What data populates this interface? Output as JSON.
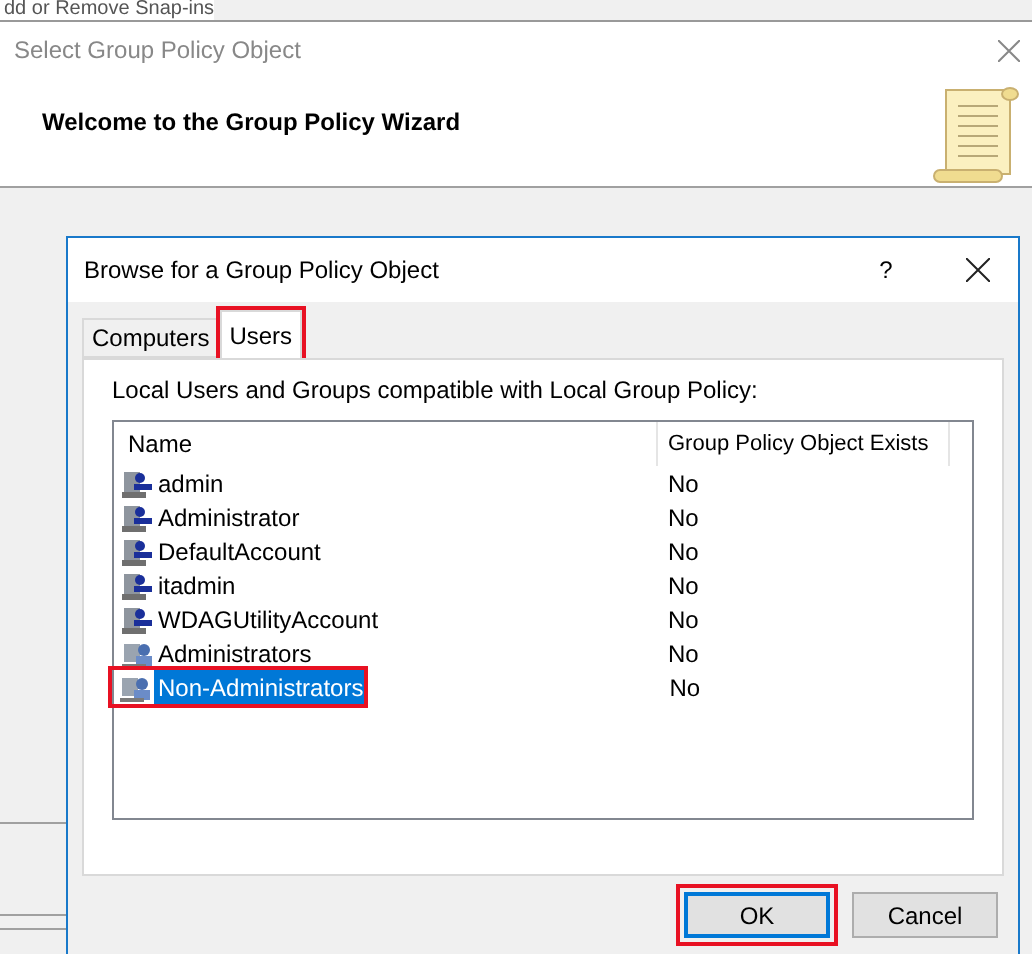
{
  "background_window": {
    "caption": "dd or Remove Snap-ins"
  },
  "wizard": {
    "title": "Select Group Policy Object",
    "heading": "Welcome to the Group Policy Wizard"
  },
  "dialog": {
    "title": "Browse for a Group Policy Object",
    "help": "?",
    "tabs": [
      {
        "label": "Computers",
        "selected": false,
        "highlighted": false
      },
      {
        "label": "Users",
        "selected": true,
        "highlighted": true
      }
    ],
    "list_label": "Local Users and Groups compatible with Local Group Policy:",
    "columns": [
      "Name",
      "Group Policy Object Exists"
    ],
    "rows": [
      {
        "kind": "user",
        "name": "admin",
        "exists": "No",
        "selected": false,
        "highlighted": false
      },
      {
        "kind": "user",
        "name": "Administrator",
        "exists": "No",
        "selected": false,
        "highlighted": false
      },
      {
        "kind": "user",
        "name": "DefaultAccount",
        "exists": "No",
        "selected": false,
        "highlighted": false
      },
      {
        "kind": "user",
        "name": "itadmin",
        "exists": "No",
        "selected": false,
        "highlighted": false
      },
      {
        "kind": "user",
        "name": "WDAGUtilityAccount",
        "exists": "No",
        "selected": false,
        "highlighted": false
      },
      {
        "kind": "group",
        "name": "Administrators",
        "exists": "No",
        "selected": false,
        "highlighted": false
      },
      {
        "kind": "group",
        "name": "Non-Administrators",
        "exists": "No",
        "selected": true,
        "highlighted": true
      }
    ],
    "buttons": [
      {
        "label": "OK",
        "default": true,
        "highlighted": true
      },
      {
        "label": "Cancel",
        "default": false,
        "highlighted": false
      }
    ]
  }
}
